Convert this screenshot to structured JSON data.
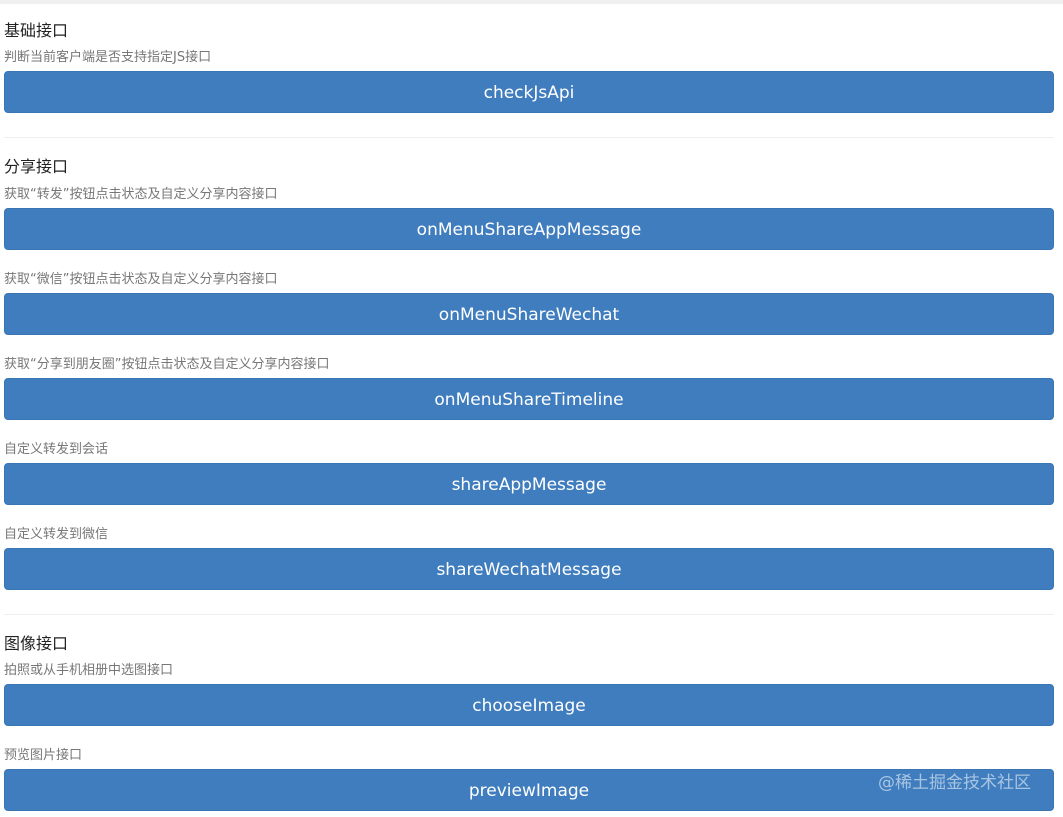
{
  "basic": {
    "title": "基础接口",
    "items": [
      {
        "desc": "判断当前客户端是否支持指定JS接口",
        "button": "checkJsApi"
      }
    ]
  },
  "share": {
    "title": "分享接口",
    "items": [
      {
        "desc": "获取“转发”按钮点击状态及自定义分享内容接口",
        "button": "onMenuShareAppMessage"
      },
      {
        "desc": "获取“微信”按钮点击状态及自定义分享内容接口",
        "button": "onMenuShareWechat"
      },
      {
        "desc": "获取“分享到朋友圈”按钮点击状态及自定义分享内容接口",
        "button": "onMenuShareTimeline"
      },
      {
        "desc": "自定义转发到会话",
        "button": "shareAppMessage"
      },
      {
        "desc": "自定义转发到微信",
        "button": "shareWechatMessage"
      }
    ]
  },
  "image": {
    "title": "图像接口",
    "items": [
      {
        "desc": "拍照或从手机相册中选图接口",
        "button": "chooseImage"
      },
      {
        "desc": "预览图片接口",
        "button": "previewImage"
      }
    ]
  },
  "watermark": "@稀土掘金技术社区",
  "colors": {
    "button_bg": "#3f7dbe",
    "button_text": "#ffffff",
    "desc_text": "#777777",
    "title_text": "#222222"
  }
}
